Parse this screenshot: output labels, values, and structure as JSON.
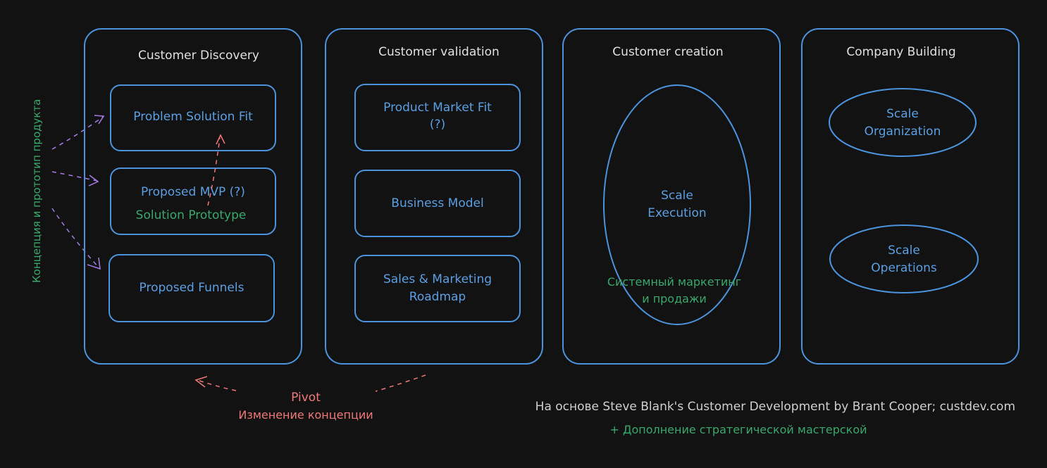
{
  "colors": {
    "background": "#121212",
    "box_stroke": "#4b93dc",
    "inner_text": "#5b9fe3",
    "stage_title": "#e0e0e0",
    "green_note": "#39a86b",
    "pivot_red": "#f07878",
    "arrow_purple": "#a67ce8",
    "footer": "#cfcfcf"
  },
  "side_label": "Концепция и прототип продукта",
  "stages": {
    "discovery": {
      "title": "Customer Discovery",
      "items": [
        "Problem Solution Fit",
        "Proposed MVP (?)",
        "Proposed Funnels"
      ],
      "mvp_note": "Solution Prototype"
    },
    "validation": {
      "title": "Customer validation",
      "items": [
        [
          "Product Market Fit",
          "(?)"
        ],
        [
          "Business Model"
        ],
        [
          "Sales & Marketing",
          "Roadmap"
        ]
      ]
    },
    "creation": {
      "title": "Customer creation",
      "ellipse": [
        "Scale",
        "Execution"
      ],
      "note": [
        "Системный маркетинг",
        "и продажи"
      ]
    },
    "building": {
      "title": "Company Building",
      "ellipses": [
        [
          "Scale",
          "Organization"
        ],
        [
          "Scale",
          "Operations"
        ]
      ]
    }
  },
  "pivot": {
    "label": "Pivot",
    "sublabel": "Изменение концепции"
  },
  "footer": {
    "source": "На основе Steve Blank's Customer Development by Brant Cooper; custdev.com",
    "addition": "+ Дополнение стратегической мастерской"
  }
}
